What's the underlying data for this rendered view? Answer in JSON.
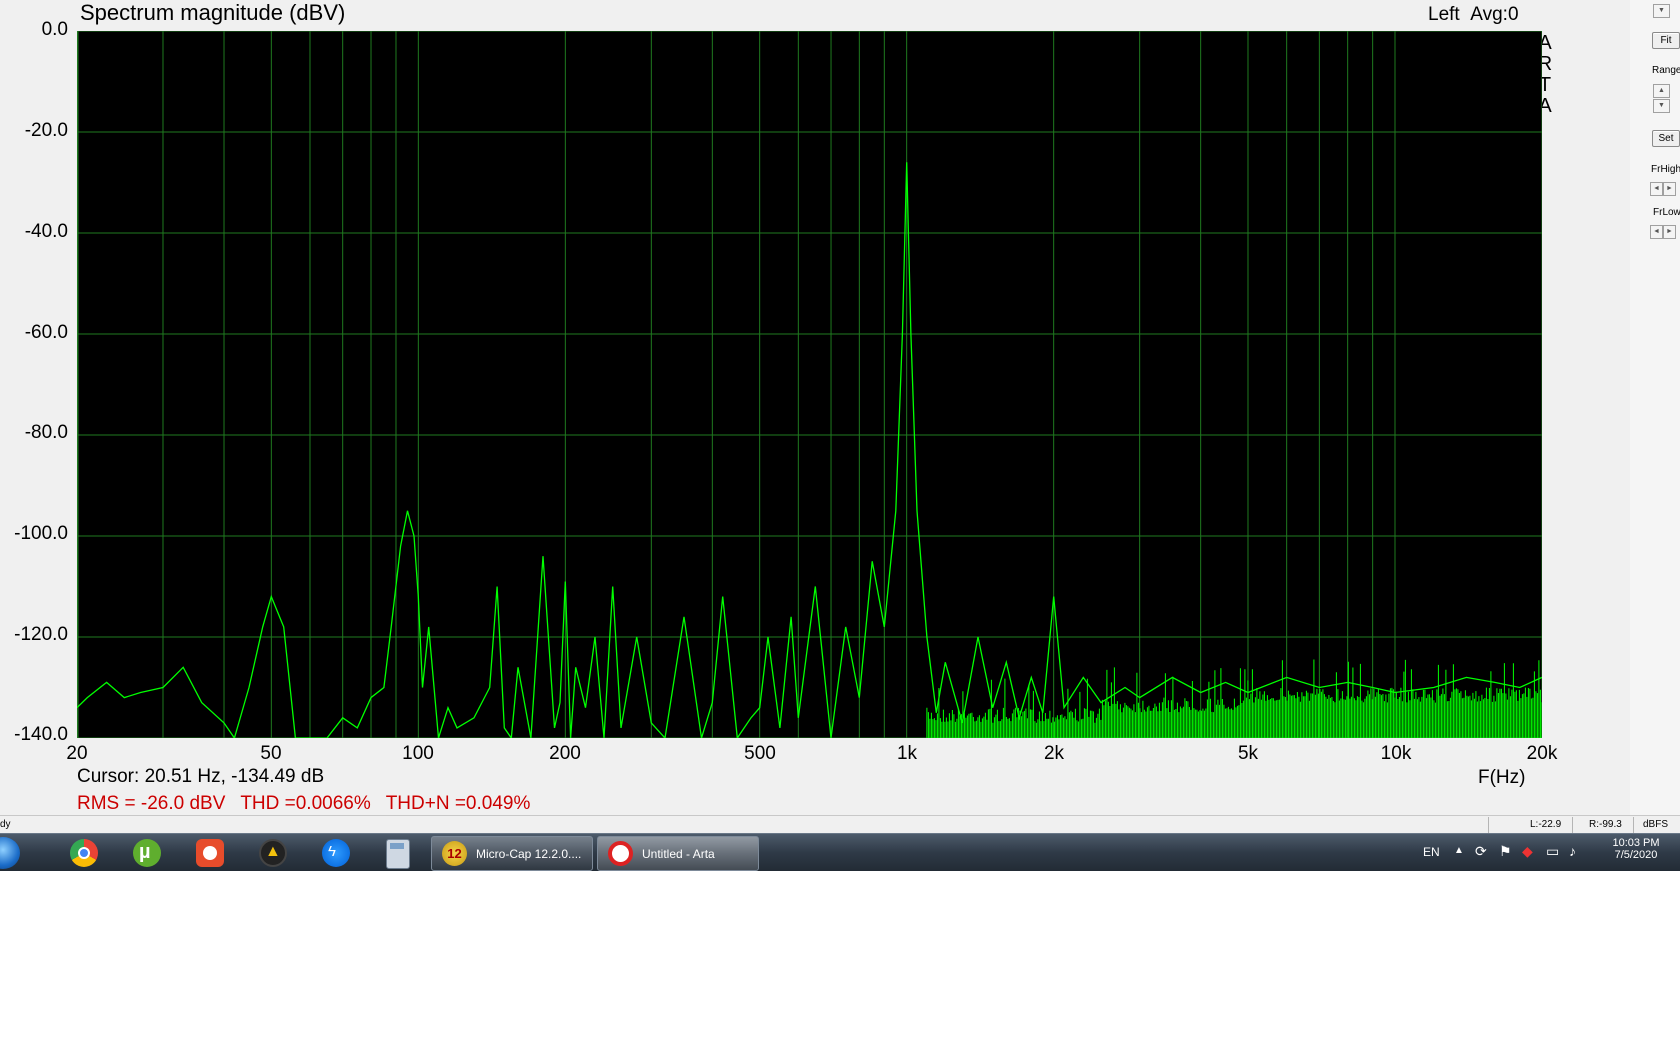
{
  "window": {
    "plot_title": "Spectrum magnitude (dBV)",
    "channel": "Left",
    "averaging": "Avg:0",
    "logo_letters": [
      "A",
      "R",
      "T",
      "A"
    ]
  },
  "chart_data": {
    "type": "line",
    "title": "Spectrum magnitude (dBV)",
    "xlabel": "F(Hz)",
    "ylabel": "",
    "x_scale": "log",
    "xlim": [
      20,
      20000
    ],
    "ylim": [
      -140,
      0
    ],
    "grid": true,
    "y_ticks": [
      "0.0",
      "-20.0",
      "-40.0",
      "-60.0",
      "-80.0",
      "-100.0",
      "-120.0",
      "-140.0"
    ],
    "y_tick_values": [
      0,
      -20,
      -40,
      -60,
      -80,
      -100,
      -120,
      -140
    ],
    "x_ticks": [
      "20",
      "50",
      "100",
      "200",
      "500",
      "1k",
      "2k",
      "5k",
      "10k",
      "20k"
    ],
    "x_tick_values": [
      20,
      50,
      100,
      200,
      500,
      1000,
      2000,
      5000,
      10000,
      20000
    ],
    "line_color": "#00ff00",
    "background": "#000000",
    "grid_color": "#1f7a1f",
    "series": [
      {
        "x": [
          20,
          21,
          23,
          25,
          27,
          30,
          33,
          36,
          40,
          42,
          45,
          48,
          50,
          53,
          56,
          60,
          65,
          70,
          75,
          80,
          85,
          88,
          92,
          95,
          98,
          100,
          102,
          105,
          110,
          115,
          120,
          130,
          140,
          145,
          150,
          155,
          160,
          170,
          180,
          190,
          195,
          200,
          205,
          210,
          220,
          230,
          240,
          250,
          260,
          280,
          300,
          320,
          350,
          380,
          400,
          420,
          450,
          480,
          500,
          520,
          550,
          580,
          600,
          650,
          700,
          750,
          800,
          850,
          900,
          950,
          980,
          1000,
          1020,
          1050,
          1100,
          1150,
          1200,
          1300,
          1400,
          1500,
          1600,
          1700,
          1800,
          1900,
          2000,
          2100,
          2300,
          2500,
          2800,
          3000,
          3500,
          4000,
          4500,
          5000,
          6000,
          7000,
          8000,
          9000,
          10000,
          12000,
          14000,
          16000,
          18000,
          20000
        ],
        "y": [
          -134,
          -132,
          -129,
          -132,
          -131,
          -130,
          -126,
          -133,
          -137,
          -140,
          -130,
          -118,
          -112,
          -118,
          -140,
          -141,
          -140,
          -136,
          -138,
          -132,
          -130,
          -118,
          -102,
          -95,
          -100,
          -112,
          -130,
          -118,
          -140,
          -134,
          -138,
          -136,
          -130,
          -110,
          -138,
          -140,
          -126,
          -140,
          -104,
          -138,
          -133,
          -109,
          -140,
          -126,
          -134,
          -120,
          -140,
          -110,
          -138,
          -120,
          -137,
          -140,
          -116,
          -140,
          -133,
          -112,
          -140,
          -136,
          -134,
          -120,
          -138,
          -116,
          -136,
          -110,
          -140,
          -118,
          -132,
          -105,
          -118,
          -95,
          -60,
          -26,
          -60,
          -95,
          -120,
          -135,
          -125,
          -137,
          -120,
          -134,
          -125,
          -136,
          -128,
          -135,
          -112,
          -134,
          -128,
          -133,
          -130,
          -132,
          -128,
          -131,
          -129,
          -131,
          -128,
          -130,
          -129,
          -130,
          -131,
          -130,
          -128,
          -129,
          -130,
          -128
        ]
      }
    ]
  },
  "readouts": {
    "cursor": "Cursor: 20.51 Hz, -134.49 dB",
    "rms": "RMS =  -26.0 dBV",
    "thd": "THD =0.0066%",
    "thdn": "THD+N =0.049%"
  },
  "side_panel": {
    "fit_label": "Fit",
    "range_label": "Range",
    "set_label": "Set",
    "frhigh_label": "FrHigh",
    "frlow_label": "FrLow"
  },
  "status_bar": {
    "left_text": "dy",
    "level_left": "L:-22.9",
    "level_right": "R:-99.3",
    "units": "dBFS"
  },
  "taskbar": {
    "pinned_icons": [
      "start-orb-icon",
      "chrome-icon",
      "utorrent-icon",
      "gom-player-icon",
      "xmind-icon",
      "messenger-icon",
      "calculator-icon"
    ],
    "windows": [
      {
        "label": "Micro-Cap 12.2.0....",
        "icon": "microcap-icon"
      },
      {
        "label": "Untitled - Arta",
        "icon": "arta-icon"
      }
    ],
    "language": "EN",
    "time": "10:03 PM",
    "date": "7/5/2020"
  }
}
